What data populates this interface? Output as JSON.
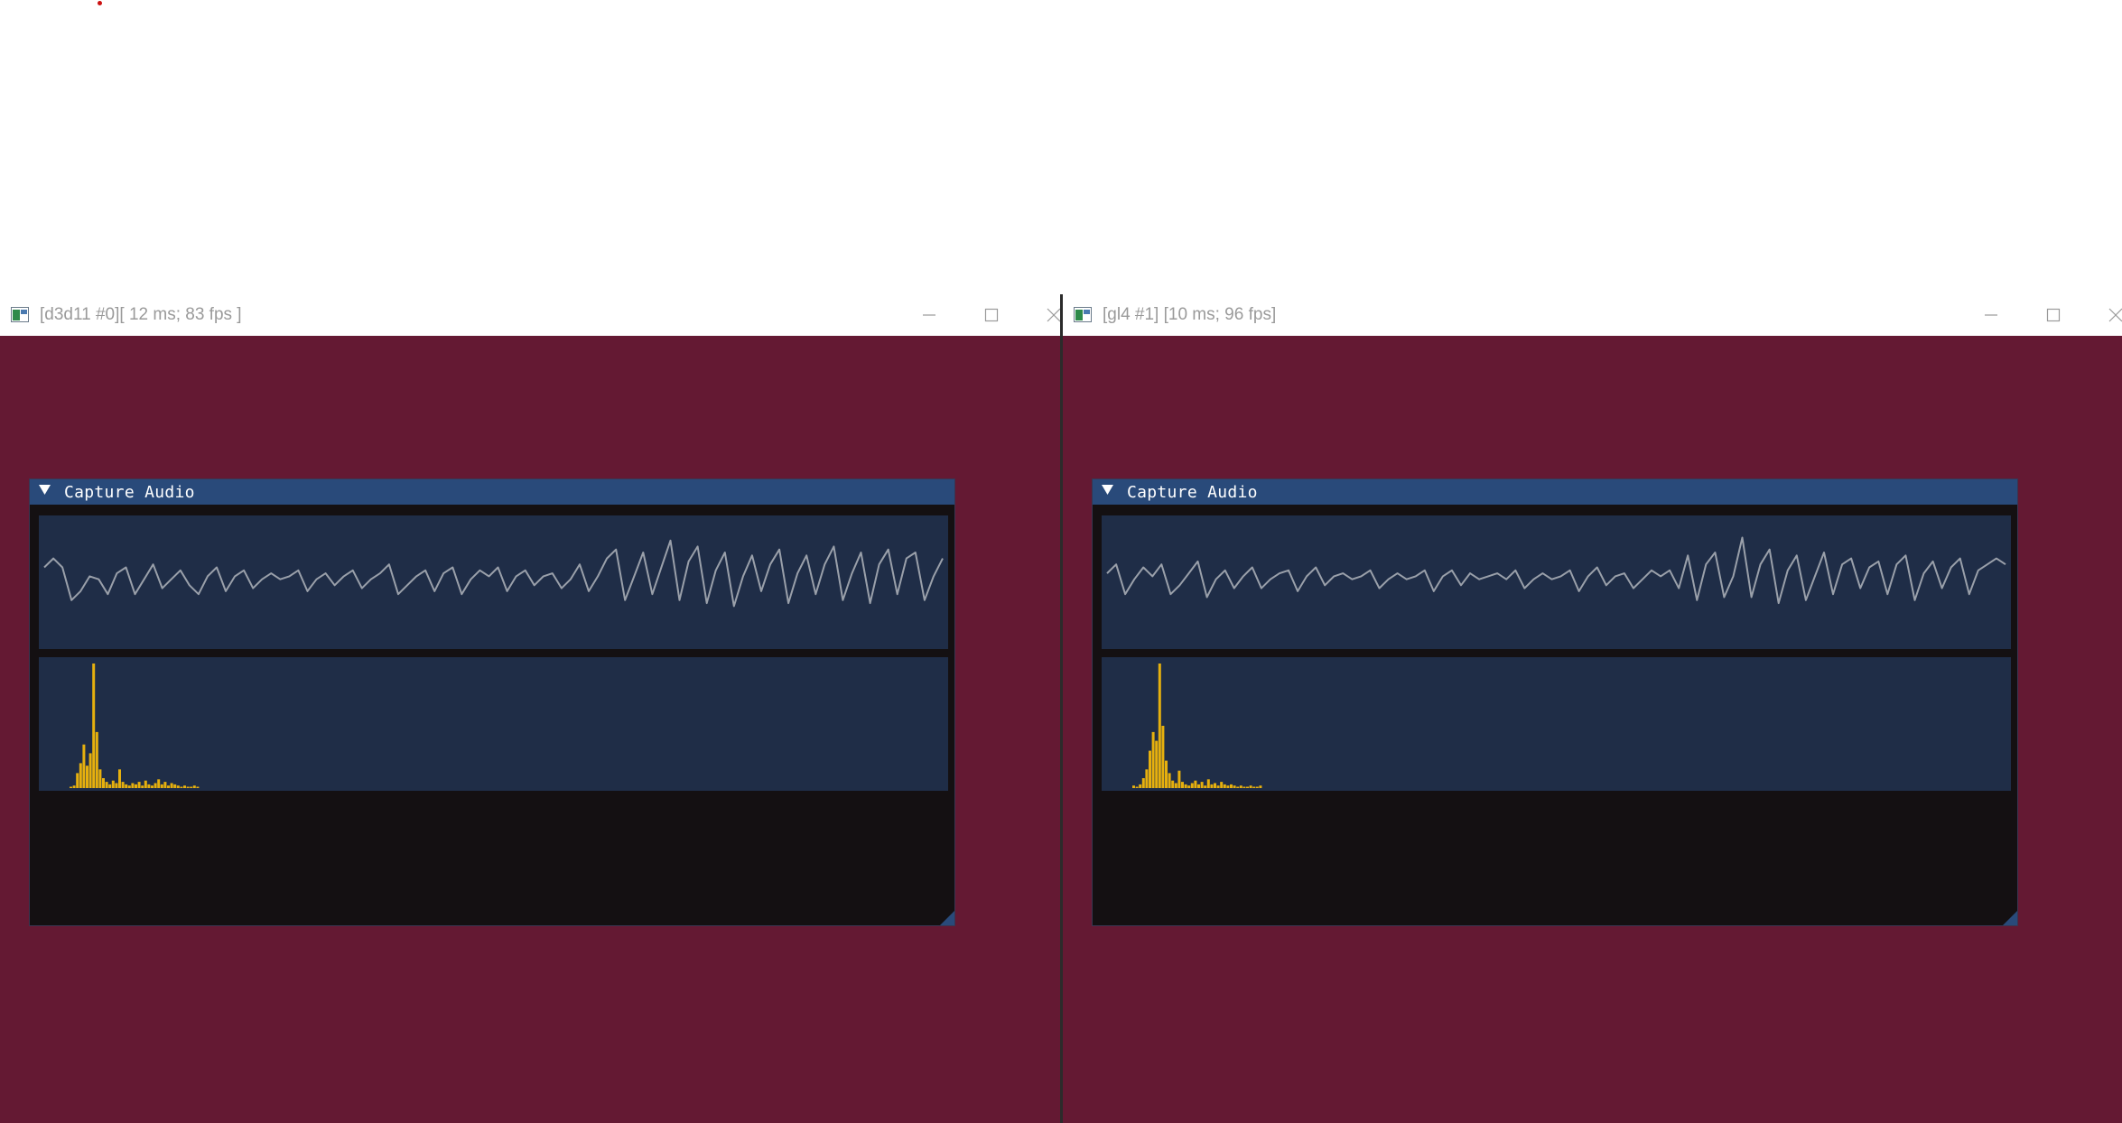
{
  "os_windows": [
    {
      "title": "[d3d11 #0][ 12 ms; 83 fps ]",
      "app_icon": "window-app-icon",
      "client_background": "#641933",
      "imgui_window": {
        "title": "Capture Audio",
        "collapse_icon": "triangle-down-icon",
        "waveform_line_color": "#9aa0aa",
        "waveform": [
          0.25,
          0.4,
          0.25,
          -0.3,
          -0.15,
          0.1,
          0.05,
          -0.2,
          0.15,
          0.25,
          -0.2,
          0.05,
          0.3,
          -0.1,
          0.05,
          0.2,
          -0.05,
          -0.2,
          0.1,
          0.25,
          -0.15,
          0.1,
          0.2,
          -0.1,
          0.05,
          0.15,
          0.05,
          0.1,
          0.2,
          -0.15,
          0.05,
          0.15,
          -0.05,
          0.1,
          0.2,
          -0.1,
          0.05,
          0.15,
          0.3,
          -0.2,
          -0.05,
          0.1,
          0.2,
          -0.15,
          0.15,
          0.25,
          -0.2,
          0.05,
          0.2,
          0.1,
          0.25,
          -0.15,
          0.1,
          0.2,
          -0.05,
          0.1,
          0.15,
          -0.1,
          0.05,
          0.3,
          -0.15,
          0.1,
          0.4,
          0.55,
          -0.3,
          0.1,
          0.5,
          -0.2,
          0.25,
          0.7,
          -0.3,
          0.35,
          0.6,
          -0.35,
          0.2,
          0.5,
          -0.4,
          0.1,
          0.45,
          -0.15,
          0.3,
          0.55,
          -0.35,
          0.15,
          0.45,
          -0.2,
          0.3,
          0.6,
          -0.3,
          0.15,
          0.5,
          -0.35,
          0.3,
          0.55,
          -0.2,
          0.4,
          0.5,
          -0.3,
          0.1,
          0.4
        ],
        "spectrum_bar_color": "#e6b00e",
        "spectrum": [
          0.01,
          0.02,
          0.12,
          0.2,
          0.35,
          0.18,
          0.28,
          1.0,
          0.45,
          0.15,
          0.08,
          0.05,
          0.03,
          0.06,
          0.04,
          0.15,
          0.05,
          0.03,
          0.02,
          0.04,
          0.03,
          0.05,
          0.02,
          0.06,
          0.03,
          0.02,
          0.04,
          0.07,
          0.03,
          0.05,
          0.02,
          0.04,
          0.03,
          0.02,
          0.01,
          0.02,
          0.01,
          0.01,
          0.02,
          0.01,
          0,
          0,
          0,
          0,
          0,
          0,
          0,
          0,
          0,
          0
        ]
      }
    },
    {
      "title": "[gl4 #1] [10 ms; 96 fps]",
      "app_icon": "window-app-icon",
      "client_background": "#641933",
      "imgui_window": {
        "title": "Capture Audio",
        "collapse_icon": "triangle-down-icon",
        "waveform_line_color": "#9aa0aa",
        "waveform": [
          0.15,
          0.3,
          -0.2,
          0.05,
          0.25,
          0.1,
          0.3,
          -0.2,
          -0.05,
          0.15,
          0.35,
          -0.25,
          0.05,
          0.2,
          -0.1,
          0.1,
          0.25,
          -0.1,
          0.05,
          0.15,
          0.2,
          -0.15,
          0.1,
          0.25,
          -0.05,
          0.1,
          0.15,
          0.05,
          0.1,
          0.2,
          -0.1,
          0.05,
          0.15,
          0.05,
          0.1,
          0.2,
          -0.15,
          0.1,
          0.2,
          -0.05,
          0.15,
          0.05,
          0.1,
          0.15,
          0.05,
          0.2,
          -0.1,
          0.05,
          0.15,
          0.05,
          0.1,
          0.2,
          -0.15,
          0.1,
          0.25,
          -0.05,
          0.1,
          0.15,
          -0.1,
          0.05,
          0.2,
          0.1,
          0.2,
          -0.1,
          0.45,
          -0.3,
          0.3,
          0.5,
          -0.25,
          0.1,
          0.75,
          -0.25,
          0.3,
          0.55,
          -0.35,
          0.2,
          0.45,
          -0.3,
          0.1,
          0.5,
          -0.2,
          0.3,
          0.4,
          -0.1,
          0.25,
          0.35,
          -0.2,
          0.3,
          0.45,
          -0.3,
          0.15,
          0.35,
          -0.1,
          0.25,
          0.4,
          -0.2,
          0.2,
          0.3,
          0.4,
          0.3
        ],
        "spectrum_bar_color": "#e6b00e",
        "spectrum": [
          0.02,
          0.01,
          0.03,
          0.08,
          0.15,
          0.3,
          0.45,
          0.38,
          1.0,
          0.5,
          0.22,
          0.12,
          0.06,
          0.04,
          0.14,
          0.05,
          0.03,
          0.02,
          0.04,
          0.06,
          0.03,
          0.05,
          0.02,
          0.07,
          0.03,
          0.04,
          0.02,
          0.05,
          0.03,
          0.02,
          0.03,
          0.02,
          0.01,
          0.02,
          0.01,
          0.01,
          0.02,
          0.01,
          0.01,
          0.02,
          0,
          0,
          0,
          0,
          0,
          0,
          0,
          0,
          0,
          0
        ]
      }
    }
  ]
}
